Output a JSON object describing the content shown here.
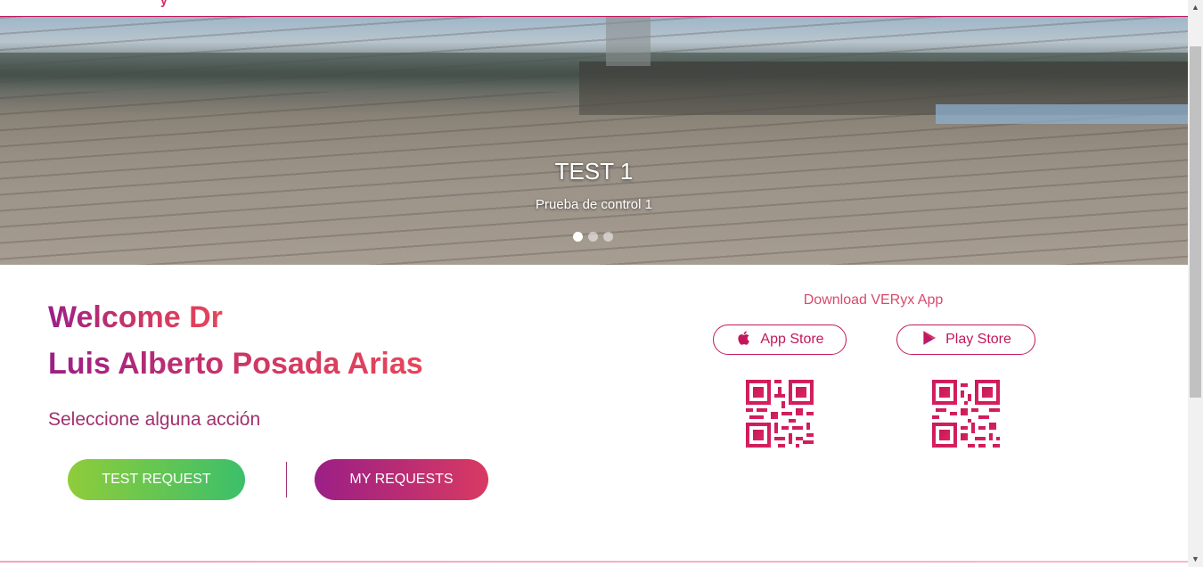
{
  "topbar": {
    "logo_fragment": "y"
  },
  "hero": {
    "slide_title": "TEST 1",
    "slide_subtitle": "Prueba de control 1",
    "slides": 3,
    "active_slide": 1
  },
  "welcome": {
    "line1": "Welcome Dr",
    "line2": "Luis Alberto Posada Arias",
    "prompt": "Seleccione alguna acción"
  },
  "actions": {
    "test_request": "TEST REQUEST",
    "my_requests": "MY REQUESTS"
  },
  "download": {
    "title": "Download VERyx App",
    "app_store": "App Store",
    "play_store": "Play Store"
  },
  "colors": {
    "brand_magenta": "#c2185b",
    "brand_gradient_start": "#9b1f86",
    "brand_gradient_end": "#d83a62",
    "green_start": "#8fcc3a",
    "green_end": "#3cbf6a"
  },
  "icons": {
    "apple": "apple-icon",
    "play": "play-store-icon",
    "qr": "qr-code"
  }
}
